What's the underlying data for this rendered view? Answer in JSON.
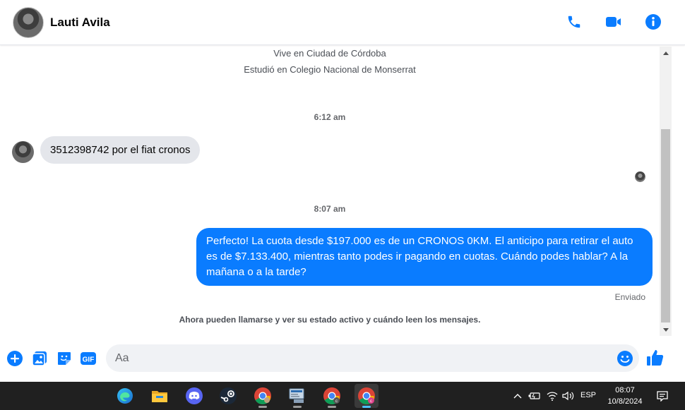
{
  "header": {
    "contact_name": "Lauti Avila",
    "actions": [
      "phone-icon",
      "video-camera-icon",
      "info-icon"
    ],
    "accent_color": "#0a7cff"
  },
  "profile": {
    "lives_in": "Vive en Ciudad de Córdoba",
    "studied_at": "Estudió en Colegio Nacional de Monserrat"
  },
  "messages": [
    {
      "timestamp": "6:12 am",
      "direction": "incoming",
      "text": "3512398742 por el fiat cronos"
    },
    {
      "timestamp": "8:07 am",
      "direction": "outgoing",
      "text": "Perfecto! La cuota desde $197.000 es de un CRONOS 0KM. El anticipo para retirar el auto es de $7.133.400, mientras tanto podes ir pagando en cuotas. Cuándo podes hablar? A la mañana o a la tarde?",
      "status": "Enviado"
    }
  ],
  "notice": "Ahora pueden llamarse y ver su estado activo y cuándo leen los mensajes.",
  "composer": {
    "placeholder": "Aa",
    "value": "",
    "buttons": [
      "plus-icon",
      "photo-icon",
      "sticker-icon",
      "gif-icon"
    ],
    "gif_label": "GIF"
  },
  "taskbar": {
    "apps": [
      "edge-icon",
      "file-explorer-icon",
      "discord-icon",
      "steam-icon",
      "chrome-icon",
      "remote-desktop-icon",
      "chrome-profile-icon",
      "chrome-profile-active-icon"
    ],
    "language": "ESP",
    "time": "08:07",
    "date": "10/8/2024"
  }
}
